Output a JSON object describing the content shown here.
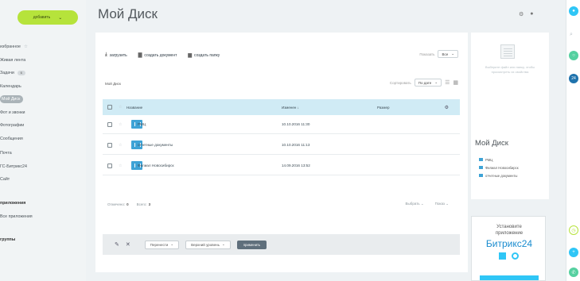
{
  "sidebar": {
    "add_button_label": "добавить",
    "items": [
      {
        "label": "избранное",
        "suffix": "☆"
      },
      {
        "label": "Живая лента",
        "counter": ""
      },
      {
        "label": "Задачи",
        "counter": "6"
      },
      {
        "label": "Календарь",
        "counter": ""
      },
      {
        "label": "Мой Диск",
        "counter": ""
      },
      {
        "label": "Фот и звонки",
        "counter": ""
      },
      {
        "label": "Фотографии",
        "counter": ""
      },
      {
        "label": "Сообщения",
        "counter": ""
      },
      {
        "label": "Почта",
        "counter": ""
      },
      {
        "label": "ГС-Битрикс24",
        "counter": ""
      },
      {
        "label": "Сайт",
        "counter": ""
      }
    ],
    "section1": "приложения",
    "section1_item": "Все приложения",
    "section2": "группы"
  },
  "header": {
    "title": "Мой Диск"
  },
  "toolbar": {
    "upload_label": "загрузить",
    "create_doc_label": "создать документ",
    "create_folder_label": "создать папку",
    "show_label": "Показать",
    "show_value": "Все"
  },
  "breadcrumb": "Мой Диск",
  "sort": {
    "label": "Сортировать",
    "value": "По дате"
  },
  "table": {
    "headers": {
      "name": "Название",
      "modified": "Изменен ↓",
      "size": "Размер"
    },
    "rows": [
      {
        "name": "РМЦ",
        "modified": "10.10.2016 11:30",
        "size": ""
      },
      {
        "name": "отчетные документы",
        "modified": "10.10.2016 11:13",
        "size": ""
      },
      {
        "name": "Филиал Новосибирск",
        "modified": "14.09.2016 13:52",
        "size": ""
      }
    ]
  },
  "footer": {
    "selected_label": "Отмечено:",
    "selected_count": "0",
    "total_label": "Всего:",
    "total_count": "3",
    "select_label": "Выбрать ⌄",
    "page_label": "Показ ⌄"
  },
  "action_bar": {
    "move_label": "Перенести",
    "level_label": "Верхний уровень",
    "apply_label": "применить"
  },
  "info": {
    "hint": "Выберите файл или папку, чтобы просмотреть их свойства",
    "title": "Мой Диск",
    "items": [
      "РМЦ",
      "Филиал Новосибирск",
      "отчетные документы"
    ]
  },
  "promo": {
    "line1": "Установите",
    "line2": "приложение",
    "brand": "Битрикс24"
  },
  "rail": {
    "badge": "24"
  },
  "colors": {
    "accent_green": "#b6e33b",
    "header_blue": "#d0ebf5",
    "folder_blue": "#3ea3d6",
    "brand_blue": "#1a8ccf"
  }
}
